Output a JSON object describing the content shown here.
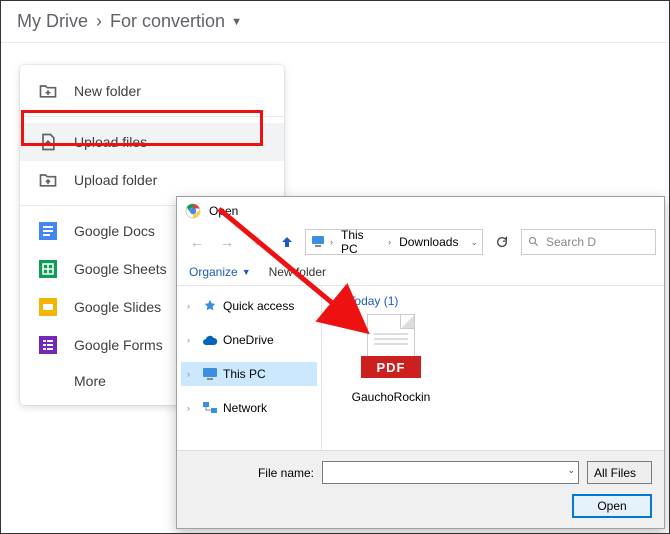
{
  "breadcrumb": {
    "root": "My Drive",
    "current": "For convertion"
  },
  "menu": {
    "new_folder": "New folder",
    "upload_files": "Upload files",
    "upload_folder": "Upload folder",
    "google_docs": "Google Docs",
    "google_sheets": "Google Sheets",
    "google_slides": "Google Slides",
    "google_forms": "Google Forms",
    "more": "More"
  },
  "dialog": {
    "title": "Open",
    "path": {
      "seg1": "This PC",
      "seg2": "Downloads"
    },
    "search_placeholder": "Search D",
    "organize": "Organize",
    "new_folder": "New folder",
    "tree": {
      "quick": "Quick access",
      "onedrive": "OneDrive",
      "thispc": "This PC",
      "network": "Network"
    },
    "group": "Today (1)",
    "file": {
      "name": "GauchoRockin",
      "badge": "PDF"
    },
    "filename_label": "File name:",
    "filter": "All Files",
    "open_btn": "Open"
  }
}
